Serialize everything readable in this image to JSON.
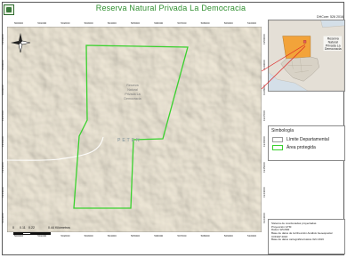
{
  "header": {
    "title": "Reserva Natural Privada La Democracia",
    "code": "DHCore: 526 2016"
  },
  "map": {
    "reserve_label_lines": [
      "Reserva",
      "Natural",
      "Privada La",
      "Democracia"
    ],
    "department_label": "PETEN",
    "top_ticks": [
      "500000",
      "501000",
      "502000",
      "503000",
      "504000",
      "505000",
      "506000",
      "507000",
      "508000",
      "509000",
      "510000"
    ],
    "bottom_ticks": [
      "500000",
      "501000",
      "502000",
      "503000",
      "504000",
      "505000",
      "506000",
      "507000",
      "508000",
      "509000",
      "510000"
    ],
    "side_ticks": [
      "1950000",
      "1949000",
      "1948000",
      "1947000",
      "1946000",
      "1945000",
      "1944000",
      "1943000"
    ],
    "colors": {
      "terrain": "#ede6d4",
      "boundary": "#39d12e",
      "road": "#ffffff"
    }
  },
  "scale": {
    "ticks": [
      "0",
      "0.11",
      "0.22",
      "0.44 Kilómetros"
    ]
  },
  "inset": {
    "label_lines": [
      "Reserva",
      "Natural",
      "Privada La",
      "Democracia"
    ],
    "colors": {
      "water": "#d4dfe8",
      "land": "#e4dfd6",
      "department": "#f2a33a",
      "highlight": "#e25b5b"
    }
  },
  "legend": {
    "title": "Simbología",
    "items": [
      {
        "label": "Límite Departamental"
      },
      {
        "label": "Área protegida"
      }
    ]
  },
  "info": {
    "lines": [
      "Sistema de coordenadas proyectadas",
      "Proyección GTM",
      "Datum WGS84",
      "Base de datos de la Dirección Análisis Geoespacial",
      "CONAP 2016",
      "Base de datos cartográfica básica IGN 2016"
    ]
  }
}
